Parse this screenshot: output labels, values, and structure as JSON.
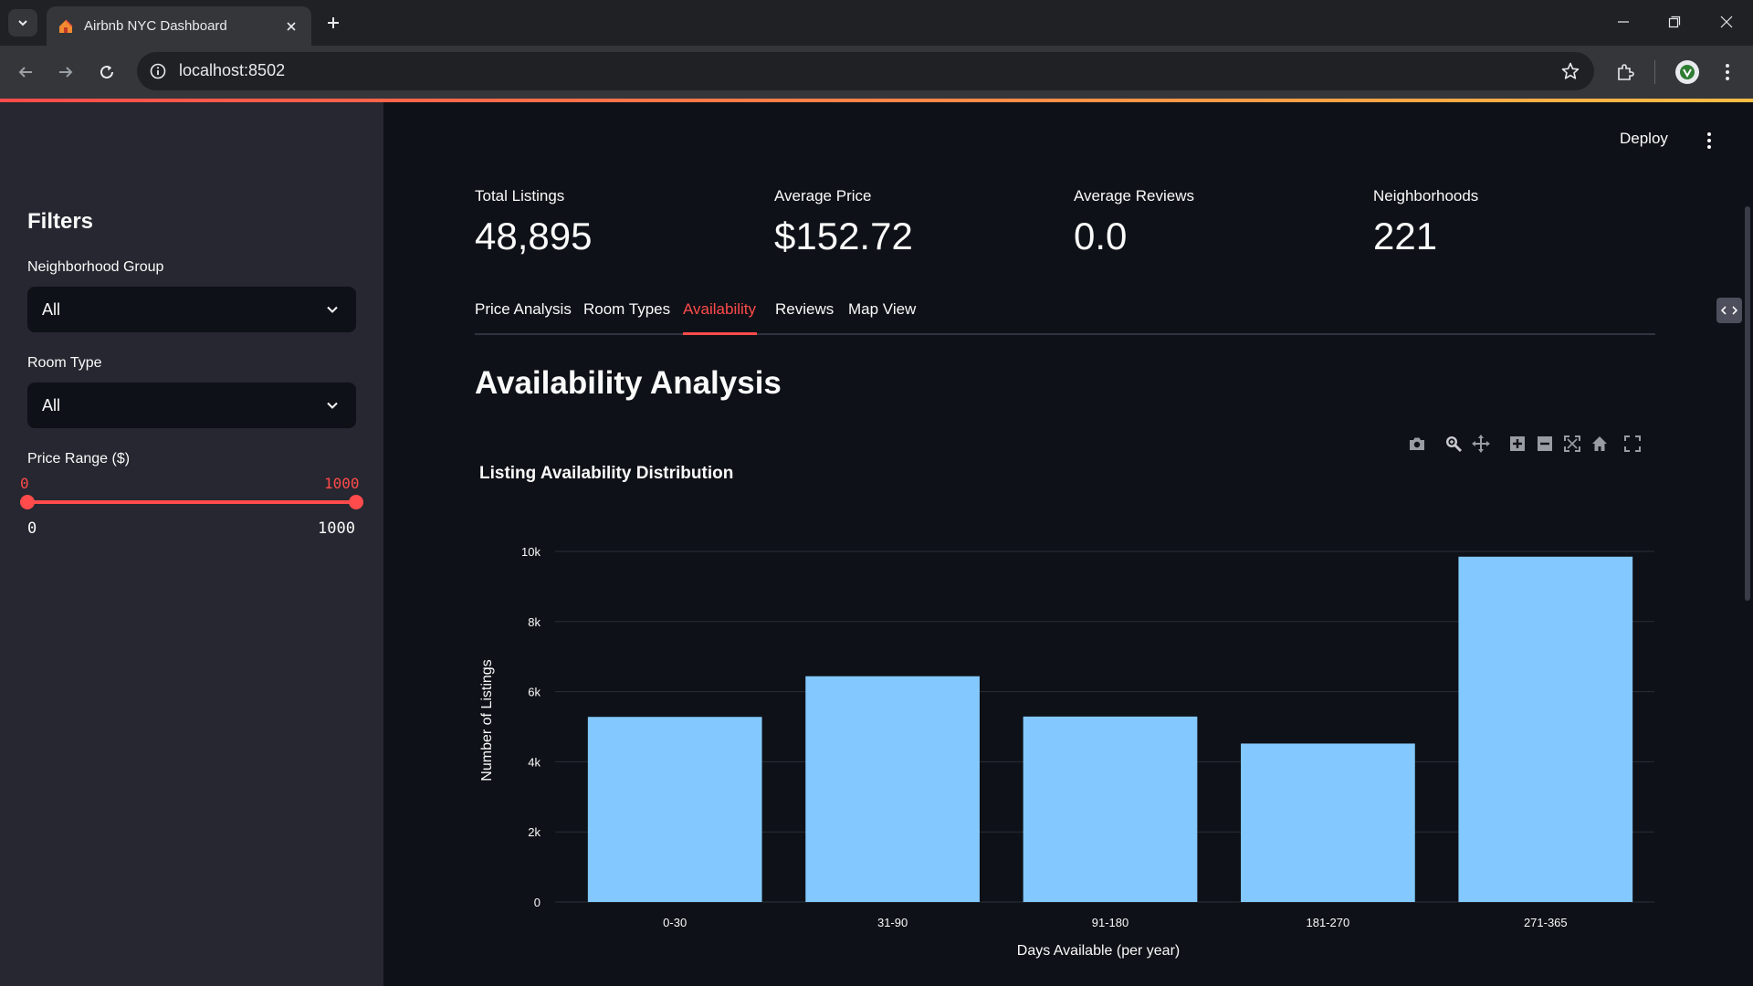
{
  "browser": {
    "tab_title": "Airbnb NYC Dashboard",
    "url": "localhost:8502"
  },
  "app": {
    "deploy_label": "Deploy"
  },
  "sidebar": {
    "title": "Filters",
    "neighborhood_group": {
      "label": "Neighborhood Group",
      "value": "All"
    },
    "room_type": {
      "label": "Room Type",
      "value": "All"
    },
    "price_range": {
      "label": "Price Range ($)",
      "low": "0",
      "high": "1000",
      "min_label": "0",
      "max_label": "1000",
      "low_fraction": 0,
      "high_fraction": 1
    }
  },
  "metrics": [
    {
      "label": "Total Listings",
      "value": "48,895"
    },
    {
      "label": "Average Price",
      "value": "$152.72"
    },
    {
      "label": "Average Reviews",
      "value": "0.0"
    },
    {
      "label": "Neighborhoods",
      "value": "221"
    }
  ],
  "tabs": [
    {
      "label": "Price Analysis",
      "active": false
    },
    {
      "label": "Room Types",
      "active": false
    },
    {
      "label": "Availability",
      "active": true
    },
    {
      "label": "Reviews",
      "active": false
    },
    {
      "label": "Map View",
      "active": false
    }
  ],
  "section_title": "Availability Analysis",
  "modebar_icons": [
    "camera-icon",
    "zoom-icon",
    "pan-icon",
    "zoom-in-icon",
    "zoom-out-icon",
    "autoscale-icon",
    "reset-axes-icon",
    "fullscreen-icon"
  ],
  "colors": {
    "accent": "#ff4b4b",
    "bar": "#83c9ff",
    "sidebar_bg": "#262730",
    "main_bg": "#0e1117"
  },
  "chart_data": {
    "type": "bar",
    "title": "Listing Availability Distribution",
    "xlabel": "Days Available (per year)",
    "ylabel": "Number of Listings",
    "categories": [
      "0-30",
      "31-90",
      "91-180",
      "181-270",
      "271-365"
    ],
    "values": [
      5280,
      6440,
      5290,
      4520,
      9850
    ],
    "ylim": [
      0,
      10000
    ],
    "yticks": [
      0,
      2000,
      4000,
      6000,
      8000,
      10000
    ],
    "ytick_labels": [
      "0",
      "2k",
      "4k",
      "6k",
      "8k",
      "10k"
    ],
    "grid": true,
    "legend": "none"
  }
}
